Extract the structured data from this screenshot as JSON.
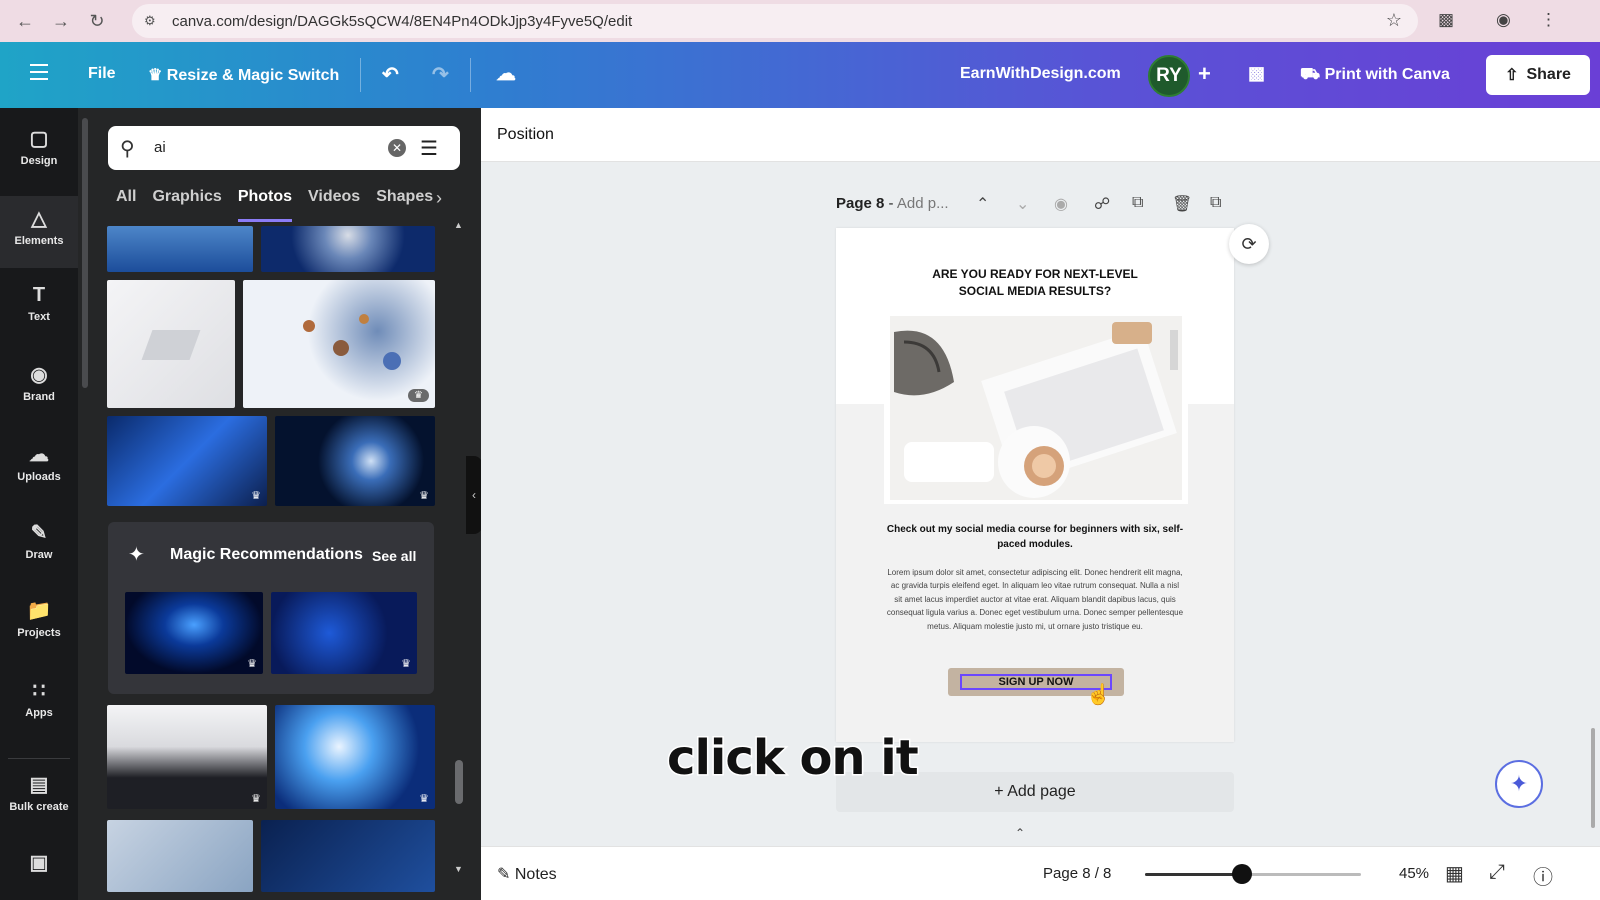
{
  "browser": {
    "url": "canva.com/design/DAGGk5sQCW4/8EN4Pn4ODkJjp3y4Fyve5Q/edit",
    "icons": [
      "back-icon",
      "forward-icon",
      "reload-icon",
      "site-info-icon",
      "star-icon",
      "extensions-icon",
      "profile-icon",
      "menu-icon"
    ]
  },
  "toolbar": {
    "file": "File",
    "resize": "Resize & Magic Switch",
    "brand_site": "EarnWithDesign.com",
    "avatar_initials": "RY",
    "print": "Print with Canva",
    "share": "Share",
    "colors": {
      "gradient_start": "#1fa4c7",
      "gradient_end": "#6a3fd6"
    }
  },
  "rail": {
    "items": [
      {
        "label": "Design",
        "icon": "design-icon"
      },
      {
        "label": "Elements",
        "icon": "elements-icon"
      },
      {
        "label": "Text",
        "icon": "text-icon"
      },
      {
        "label": "Brand",
        "icon": "brand-icon"
      },
      {
        "label": "Uploads",
        "icon": "uploads-icon"
      },
      {
        "label": "Draw",
        "icon": "draw-icon"
      },
      {
        "label": "Projects",
        "icon": "projects-icon"
      },
      {
        "label": "Apps",
        "icon": "apps-icon"
      },
      {
        "label": "Bulk create",
        "icon": "bulk-create-icon"
      }
    ],
    "active": "Elements"
  },
  "panel": {
    "search_value": "ai",
    "tabs": [
      "All",
      "Graphics",
      "Photos",
      "Videos",
      "Shapes"
    ],
    "selected_tab": "Photos",
    "magic_title": "Magic Recommendations",
    "see_all": "See all"
  },
  "canvas": {
    "position_header": "Position",
    "page_label": "Page 8",
    "page_title_placeholder": "Add p...",
    "design": {
      "headline_line1": "ARE YOU READY FOR NEXT-LEVEL",
      "headline_line2": "SOCIAL MEDIA RESULTS?",
      "lead": "Check out my social media course for beginners with six, self-paced modules.",
      "body": "Lorem ipsum dolor sit amet, consectetur adipiscing elit. Donec hendrerit elit magna, ac gravida turpis eleifend eget. In aliquam leo vitae rutrum consequat. Nulla a nisl sit amet lacus imperdiet auctor at vitae erat. Aliquam blandit dapibus lacus, quis consequat ligula varius a. Donec eget vestibulum urna. Donec semper pellentesque metus. Aliquam molestie justo mi, ut ornare justo tristique eu.",
      "cta": "SIGN UP NOW"
    },
    "add_page": "+ Add page",
    "caption": "click on it"
  },
  "footer": {
    "notes": "Notes",
    "page_count": "Page 8 / 8",
    "zoom": "45%",
    "zoom_level": 0.45
  }
}
